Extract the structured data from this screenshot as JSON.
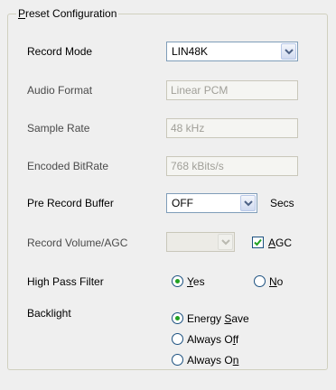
{
  "group": {
    "title": "Preset Configuration"
  },
  "record_mode": {
    "label": "Record Mode",
    "value": "LIN48K"
  },
  "audio_format": {
    "label": "Audio Format",
    "value": "Linear PCM"
  },
  "sample_rate": {
    "label": "Sample Rate",
    "value": "48 kHz"
  },
  "encoded_bitrate": {
    "label": "Encoded BitRate",
    "value": "768 kBits/s"
  },
  "pre_record_buffer": {
    "label": "Pre Record Buffer",
    "value": "OFF",
    "unit": "Secs"
  },
  "record_volume": {
    "label": "Record Volume/AGC",
    "value": "",
    "agc_label": "AGC",
    "agc_checked": true
  },
  "high_pass_filter": {
    "label": "High Pass Filter",
    "yes_label": "Yes",
    "no_label": "No",
    "selected": "Yes"
  },
  "backlight": {
    "label": "Backlight",
    "options": [
      "Energy Save",
      "Always Off",
      "Always On"
    ],
    "selected": "Energy Save"
  }
}
